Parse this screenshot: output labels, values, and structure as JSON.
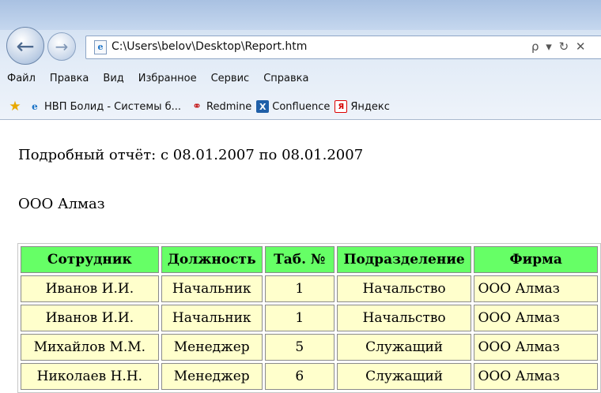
{
  "browser": {
    "address": "C:\\Users\\belov\\Desktop\\Report.htm",
    "address_tools": "ρ ▾ ↻ ✕",
    "menu": [
      "Файл",
      "Правка",
      "Вид",
      "Избранное",
      "Сервис",
      "Справка"
    ],
    "favorites": [
      {
        "label": "НВП Болид - Системы б...",
        "icon": "ie-page-icon"
      },
      {
        "label": "Redmine",
        "icon": "redmine-icon"
      },
      {
        "label": "Confluence",
        "icon": "confluence-icon"
      },
      {
        "label": "Яндекс",
        "icon": "yandex-icon"
      }
    ]
  },
  "report": {
    "title": "Подробный отчёт: с 08.01.2007 по 08.01.2007",
    "company": "ООО Алмаз",
    "columns": [
      "Сотрудник",
      "Должность",
      "Таб. №",
      "Подразделение",
      "Фирма"
    ],
    "rows": [
      [
        "Иванов И.И.",
        "Начальник",
        "1",
        "Начальство",
        "ООО Алмаз"
      ],
      [
        "Иванов И.И.",
        "Начальник",
        "1",
        "Начальство",
        "ООО Алмаз"
      ],
      [
        "Михайлов М.М.",
        "Менеджер",
        "5",
        "Служащий",
        "ООО Алмаз"
      ],
      [
        "Николаев Н.Н.",
        "Менеджер",
        "6",
        "Служащий",
        "ООО Алмаз"
      ]
    ],
    "header_color": "#66ff66",
    "cell_color": "#ffffcc"
  }
}
